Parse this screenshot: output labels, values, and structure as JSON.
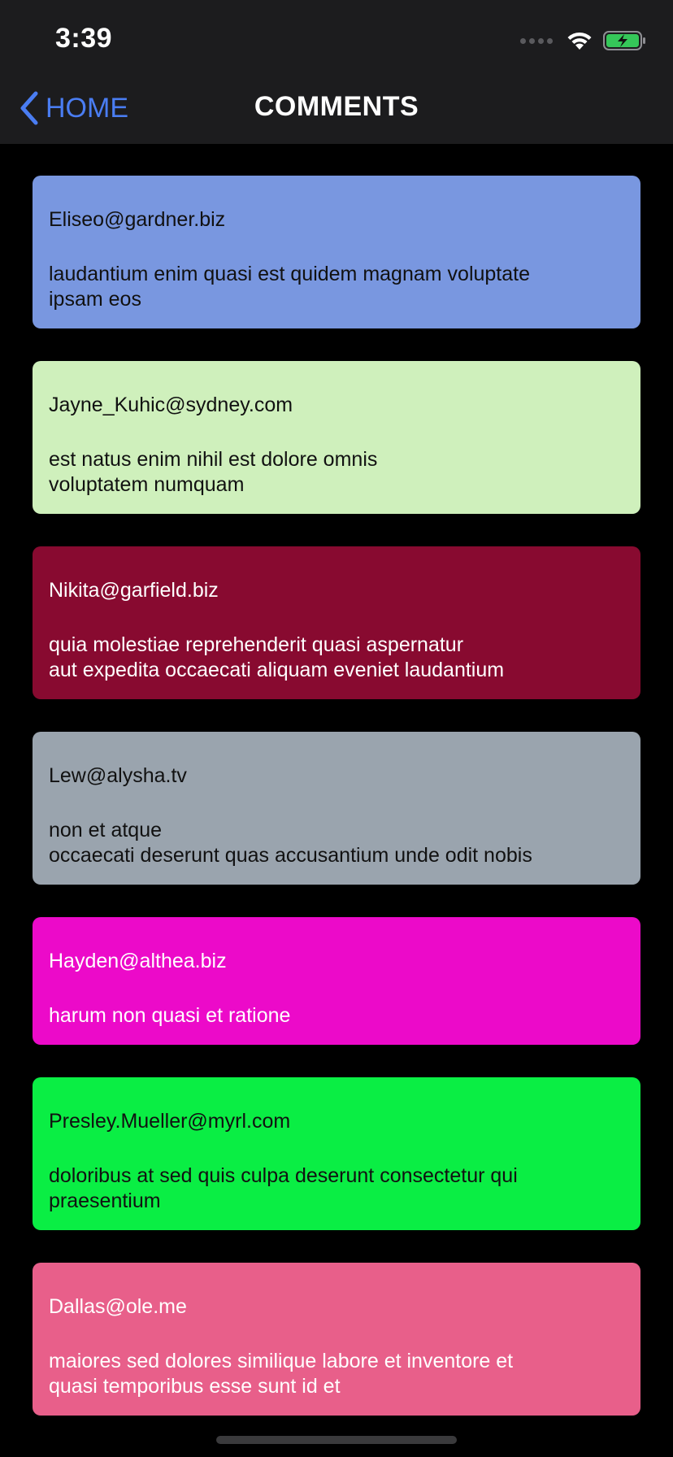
{
  "status_bar": {
    "time": "3:39",
    "icons": [
      "signal-dots-icon",
      "wifi-icon",
      "battery-charging-icon"
    ],
    "battery_color": "#35c759"
  },
  "nav": {
    "back_label": "HOME",
    "title": "COMMENTS",
    "accent_color": "#4a7df2"
  },
  "comments": [
    {
      "email": "Eliseo@gardner.biz",
      "body": "laudantium enim quasi est quidem magnam voluptate\nipsam eos",
      "color": "#7997e0",
      "text_color": "#111111"
    },
    {
      "email": "Jayne_Kuhic@sydney.com",
      "body": "est natus enim nihil est dolore omnis\nvoluptatem numquam",
      "color": "#cff0bc",
      "text_color": "#111111"
    },
    {
      "email": "Nikita@garfield.biz",
      "body": "quia molestiae reprehenderit quasi aspernatur\naut expedita occaecati aliquam eveniet laudantium",
      "color": "#880a30",
      "text_color": "#ffffff"
    },
    {
      "email": "Lew@alysha.tv",
      "body": "non et atque\noccaecati deserunt quas accusantium unde odit nobis",
      "color": "#9aa4ae",
      "text_color": "#111111"
    },
    {
      "email": "Hayden@althea.biz",
      "body": "harum non quasi et ratione",
      "color": "#ec0ac9",
      "text_color": "#ffffff"
    },
    {
      "email": "Presley.Mueller@myrl.com",
      "body": "doloribus at sed quis culpa deserunt consectetur qui\npraesentium",
      "color": "#0aee44",
      "text_color": "#111111"
    },
    {
      "email": "Dallas@ole.me",
      "body": "maiores sed dolores similique labore et inventore et\nquasi temporibus esse sunt id et",
      "color": "#e85f8a",
      "text_color": "#ffffff"
    }
  ]
}
